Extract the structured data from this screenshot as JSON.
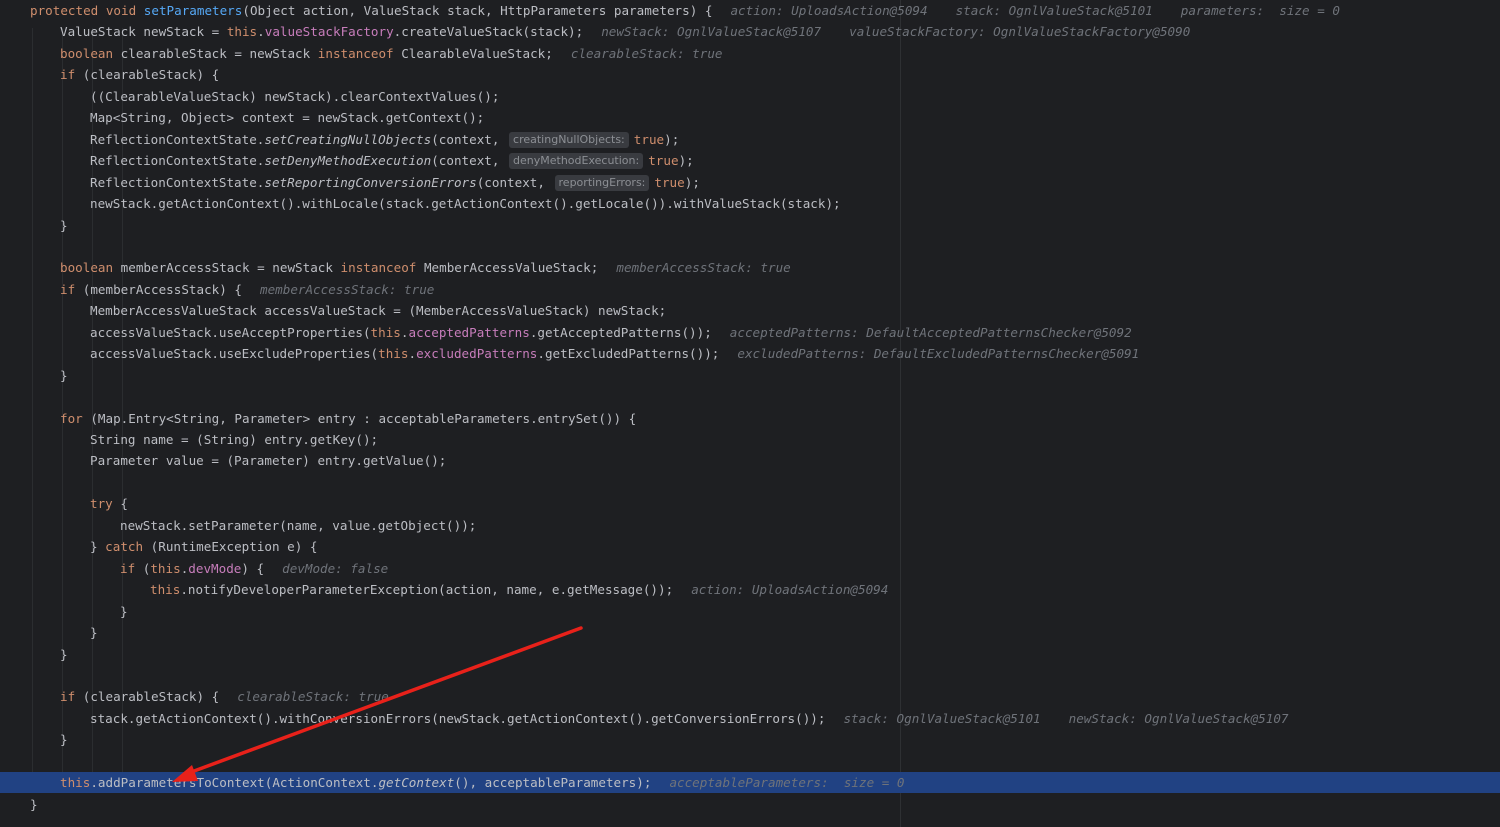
{
  "editor": {
    "lines": [
      {
        "indent": 0,
        "y": 0,
        "tokens": [
          {
            "c": "kw",
            "t": "protected"
          },
          {
            "c": "pl",
            "t": " "
          },
          {
            "c": "kw",
            "t": "void"
          },
          {
            "c": "pl",
            "t": " "
          },
          {
            "c": "fn",
            "t": "setParameters"
          },
          {
            "c": "pl",
            "t": "(Object action, ValueStack stack, HttpParameters parameters) {"
          }
        ],
        "hints": [
          "action: UploadsAction@5094",
          "stack: OgnlValueStack@5101",
          "parameters:  size = 0"
        ]
      },
      {
        "indent": 1,
        "y": 1,
        "tokens": [
          {
            "c": "pl",
            "t": "ValueStack newStack = "
          },
          {
            "c": "kw",
            "t": "this"
          },
          {
            "c": "pl",
            "t": "."
          },
          {
            "c": "fld",
            "t": "valueStackFactory"
          },
          {
            "c": "pl",
            "t": ".createValueStack(stack);"
          }
        ],
        "hints": [
          "newStack: OgnlValueStack@5107",
          "valueStackFactory: OgnlValueStackFactory@5090"
        ]
      },
      {
        "indent": 1,
        "y": 2,
        "tokens": [
          {
            "c": "kw",
            "t": "boolean"
          },
          {
            "c": "pl",
            "t": " clearableStack = newStack "
          },
          {
            "c": "kw",
            "t": "instanceof"
          },
          {
            "c": "pl",
            "t": " ClearableValueStack;"
          }
        ],
        "hints": [
          "clearableStack: true"
        ]
      },
      {
        "indent": 1,
        "y": 3,
        "tokens": [
          {
            "c": "kw",
            "t": "if"
          },
          {
            "c": "pl",
            "t": " (clearableStack) {"
          }
        ],
        "hints": []
      },
      {
        "indent": 2,
        "y": 4,
        "tokens": [
          {
            "c": "pl",
            "t": "((ClearableValueStack) newStack).clearContextValues();"
          }
        ],
        "hints": []
      },
      {
        "indent": 2,
        "y": 5,
        "tokens": [
          {
            "c": "pl",
            "t": "Map<String, Object> context = newStack.getContext();"
          }
        ],
        "hints": []
      },
      {
        "indent": 2,
        "y": 6,
        "tokens": [
          {
            "c": "pl",
            "t": "ReflectionContextState."
          },
          {
            "c": "pl it",
            "t": "setCreatingNullObjects"
          },
          {
            "c": "pl",
            "t": "(context, "
          },
          {
            "c": "param",
            "t": "creatingNullObjects:"
          },
          {
            "c": "kw",
            "t": "true"
          },
          {
            "c": "pl",
            "t": ");"
          }
        ],
        "hints": []
      },
      {
        "indent": 2,
        "y": 7,
        "tokens": [
          {
            "c": "pl",
            "t": "ReflectionContextState."
          },
          {
            "c": "pl it",
            "t": "setDenyMethodExecution"
          },
          {
            "c": "pl",
            "t": "(context, "
          },
          {
            "c": "param",
            "t": "denyMethodExecution:"
          },
          {
            "c": "kw",
            "t": "true"
          },
          {
            "c": "pl",
            "t": ");"
          }
        ],
        "hints": []
      },
      {
        "indent": 2,
        "y": 8,
        "tokens": [
          {
            "c": "pl",
            "t": "ReflectionContextState."
          },
          {
            "c": "pl it",
            "t": "setReportingConversionErrors"
          },
          {
            "c": "pl",
            "t": "(context, "
          },
          {
            "c": "param",
            "t": "reportingErrors:"
          },
          {
            "c": "kw",
            "t": "true"
          },
          {
            "c": "pl",
            "t": ");"
          }
        ],
        "hints": []
      },
      {
        "indent": 2,
        "y": 9,
        "tokens": [
          {
            "c": "pl",
            "t": "newStack.getActionContext().withLocale(stack.getActionContext().getLocale()).withValueStack(stack);"
          }
        ],
        "hints": []
      },
      {
        "indent": 1,
        "y": 10,
        "tokens": [
          {
            "c": "pl",
            "t": "}"
          }
        ],
        "hints": []
      },
      {
        "indent": 1,
        "y": 12,
        "tokens": [
          {
            "c": "kw",
            "t": "boolean"
          },
          {
            "c": "pl",
            "t": " memberAccessStack = newStack "
          },
          {
            "c": "kw",
            "t": "instanceof"
          },
          {
            "c": "pl",
            "t": " MemberAccessValueStack;"
          }
        ],
        "hints": [
          "memberAccessStack: true"
        ]
      },
      {
        "indent": 1,
        "y": 13,
        "tokens": [
          {
            "c": "kw",
            "t": "if"
          },
          {
            "c": "pl",
            "t": " (memberAccessStack) {"
          }
        ],
        "hints": [
          "memberAccessStack: true"
        ]
      },
      {
        "indent": 2,
        "y": 14,
        "tokens": [
          {
            "c": "pl",
            "t": "MemberAccessValueStack accessValueStack = (MemberAccessValueStack) newStack;"
          }
        ],
        "hints": []
      },
      {
        "indent": 2,
        "y": 15,
        "tokens": [
          {
            "c": "pl",
            "t": "accessValueStack.useAcceptProperties("
          },
          {
            "c": "kw",
            "t": "this"
          },
          {
            "c": "pl",
            "t": "."
          },
          {
            "c": "fld",
            "t": "acceptedPatterns"
          },
          {
            "c": "pl",
            "t": ".getAcceptedPatterns());"
          }
        ],
        "hints": [
          "acceptedPatterns: DefaultAcceptedPatternsChecker@5092"
        ]
      },
      {
        "indent": 2,
        "y": 16,
        "tokens": [
          {
            "c": "pl",
            "t": "accessValueStack.useExcludeProperties("
          },
          {
            "c": "kw",
            "t": "this"
          },
          {
            "c": "pl",
            "t": "."
          },
          {
            "c": "fld",
            "t": "excludedPatterns"
          },
          {
            "c": "pl",
            "t": ".getExcludedPatterns());"
          }
        ],
        "hints": [
          "excludedPatterns: DefaultExcludedPatternsChecker@5091"
        ]
      },
      {
        "indent": 1,
        "y": 17,
        "tokens": [
          {
            "c": "pl",
            "t": "}"
          }
        ],
        "hints": []
      },
      {
        "indent": 1,
        "y": 19,
        "tokens": [
          {
            "c": "kw",
            "t": "for"
          },
          {
            "c": "pl",
            "t": " (Map.Entry<String, Parameter> entry : acceptableParameters.entrySet()) {"
          }
        ],
        "hints": []
      },
      {
        "indent": 2,
        "y": 20,
        "tokens": [
          {
            "c": "pl",
            "t": "String name = (String) entry.getKey();"
          }
        ],
        "hints": []
      },
      {
        "indent": 2,
        "y": 21,
        "tokens": [
          {
            "c": "pl",
            "t": "Parameter value = (Parameter) entry.getValue();"
          }
        ],
        "hints": []
      },
      {
        "indent": 2,
        "y": 23,
        "tokens": [
          {
            "c": "kw",
            "t": "try"
          },
          {
            "c": "pl",
            "t": " {"
          }
        ],
        "hints": []
      },
      {
        "indent": 3,
        "y": 24,
        "tokens": [
          {
            "c": "pl",
            "t": "newStack.setParameter(name, value.getObject());"
          }
        ],
        "hints": []
      },
      {
        "indent": 2,
        "y": 25,
        "tokens": [
          {
            "c": "pl",
            "t": "} "
          },
          {
            "c": "kw",
            "t": "catch"
          },
          {
            "c": "pl",
            "t": " (RuntimeException e) {"
          }
        ],
        "hints": []
      },
      {
        "indent": 3,
        "y": 26,
        "tokens": [
          {
            "c": "kw",
            "t": "if"
          },
          {
            "c": "pl",
            "t": " ("
          },
          {
            "c": "kw",
            "t": "this"
          },
          {
            "c": "pl",
            "t": "."
          },
          {
            "c": "fld",
            "t": "devMode"
          },
          {
            "c": "pl",
            "t": ") {"
          }
        ],
        "hints": [
          "devMode: false"
        ]
      },
      {
        "indent": 4,
        "y": 27,
        "tokens": [
          {
            "c": "kw",
            "t": "this"
          },
          {
            "c": "pl",
            "t": ".notifyDeveloperParameterException(action, name, e.getMessage());"
          }
        ],
        "hints": [
          "action: UploadsAction@5094"
        ]
      },
      {
        "indent": 3,
        "y": 28,
        "tokens": [
          {
            "c": "pl",
            "t": "}"
          }
        ],
        "hints": []
      },
      {
        "indent": 2,
        "y": 29,
        "tokens": [
          {
            "c": "pl",
            "t": "}"
          }
        ],
        "hints": []
      },
      {
        "indent": 1,
        "y": 30,
        "tokens": [
          {
            "c": "pl",
            "t": "}"
          }
        ],
        "hints": []
      },
      {
        "indent": 1,
        "y": 32,
        "tokens": [
          {
            "c": "kw",
            "t": "if"
          },
          {
            "c": "pl",
            "t": " (clearableStack) {"
          }
        ],
        "hints": [
          "clearableStack: true"
        ]
      },
      {
        "indent": 2,
        "y": 33,
        "tokens": [
          {
            "c": "pl",
            "t": "stack.getActionContext().withConversionErrors(newStack.getActionContext().getConversionErrors());"
          }
        ],
        "hints": [
          "stack: OgnlValueStack@5101",
          "newStack: OgnlValueStack@5107"
        ]
      },
      {
        "indent": 1,
        "y": 34,
        "tokens": [
          {
            "c": "pl",
            "t": "}"
          }
        ],
        "hints": []
      },
      {
        "indent": 1,
        "y": 36,
        "highlight": true,
        "tokens": [
          {
            "c": "kw",
            "t": "this"
          },
          {
            "c": "pl",
            "t": ".addParametersToContext(ActionContext."
          },
          {
            "c": "pl it",
            "t": "getContext"
          },
          {
            "c": "pl",
            "t": "(), acceptableParameters);"
          }
        ],
        "hints": [
          "acceptableParameters:  size = 0"
        ]
      },
      {
        "indent": 0,
        "y": 37,
        "tokens": [
          {
            "c": "pl",
            "t": "}"
          }
        ],
        "hints": []
      }
    ]
  },
  "colors": {
    "background": "#1e1f22",
    "keyword": "#cf8e6d",
    "method": "#56a8f5",
    "field": "#c77dbb",
    "inlay_hint": "#6f737a",
    "execution_line": "#214283",
    "annotation_arrow": "#e8211a"
  },
  "annotation": {
    "type": "arrow",
    "points_to": "addParametersToContext call (current execution line)"
  }
}
